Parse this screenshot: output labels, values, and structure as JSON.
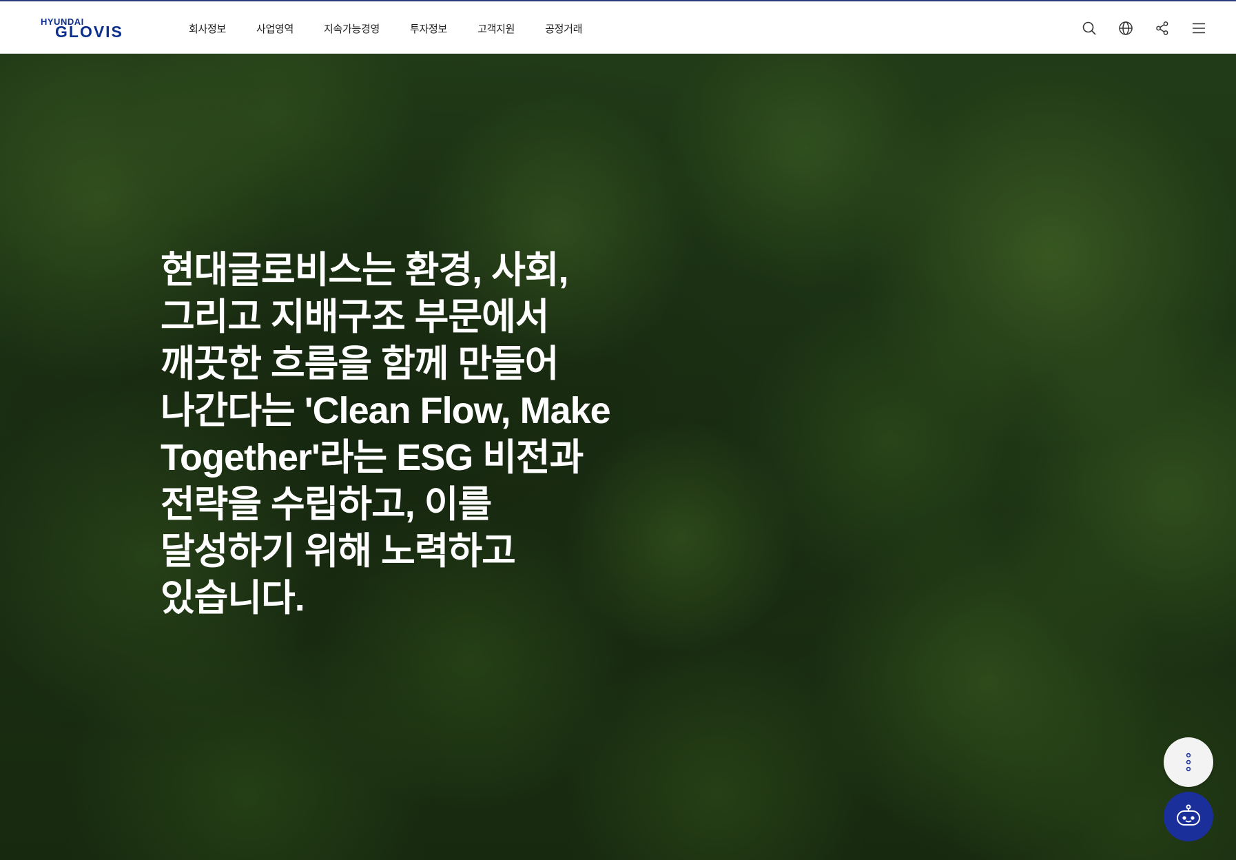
{
  "header": {
    "logo": {
      "small_text": "HYUNDAI",
      "big_text": "GLOVIS"
    },
    "nav": [
      {
        "label": "회사정보"
      },
      {
        "label": "사업영역"
      },
      {
        "label": "지속가능경영"
      },
      {
        "label": "투자정보"
      },
      {
        "label": "고객지원"
      },
      {
        "label": "공정거래"
      }
    ],
    "utilities": [
      {
        "icon": "search-icon"
      },
      {
        "icon": "globe-icon"
      },
      {
        "icon": "share-icon"
      },
      {
        "icon": "hamburger-menu-icon"
      }
    ]
  },
  "hero": {
    "headline_lines": [
      "현대글로비스는 환경, 사회,",
      "그리고 지배구조 부문에서",
      "깨끗한 흐름을 함께 만들어",
      "나간다는 'Clean Flow, Make",
      "Together'라는 ESG 비전과",
      "전략을 수립하고, 이를",
      "달성하기 위해 노력하고",
      "있습니다."
    ]
  },
  "floating": {
    "more_icon": "vertical-dots-icon",
    "chat_icon": "chatbot-icon"
  },
  "colors": {
    "brand": "#0b2f8f",
    "chat_button": "#1a2f9a",
    "header_top_border": "#2b3a7a",
    "forest_dark": "#1d3314"
  }
}
